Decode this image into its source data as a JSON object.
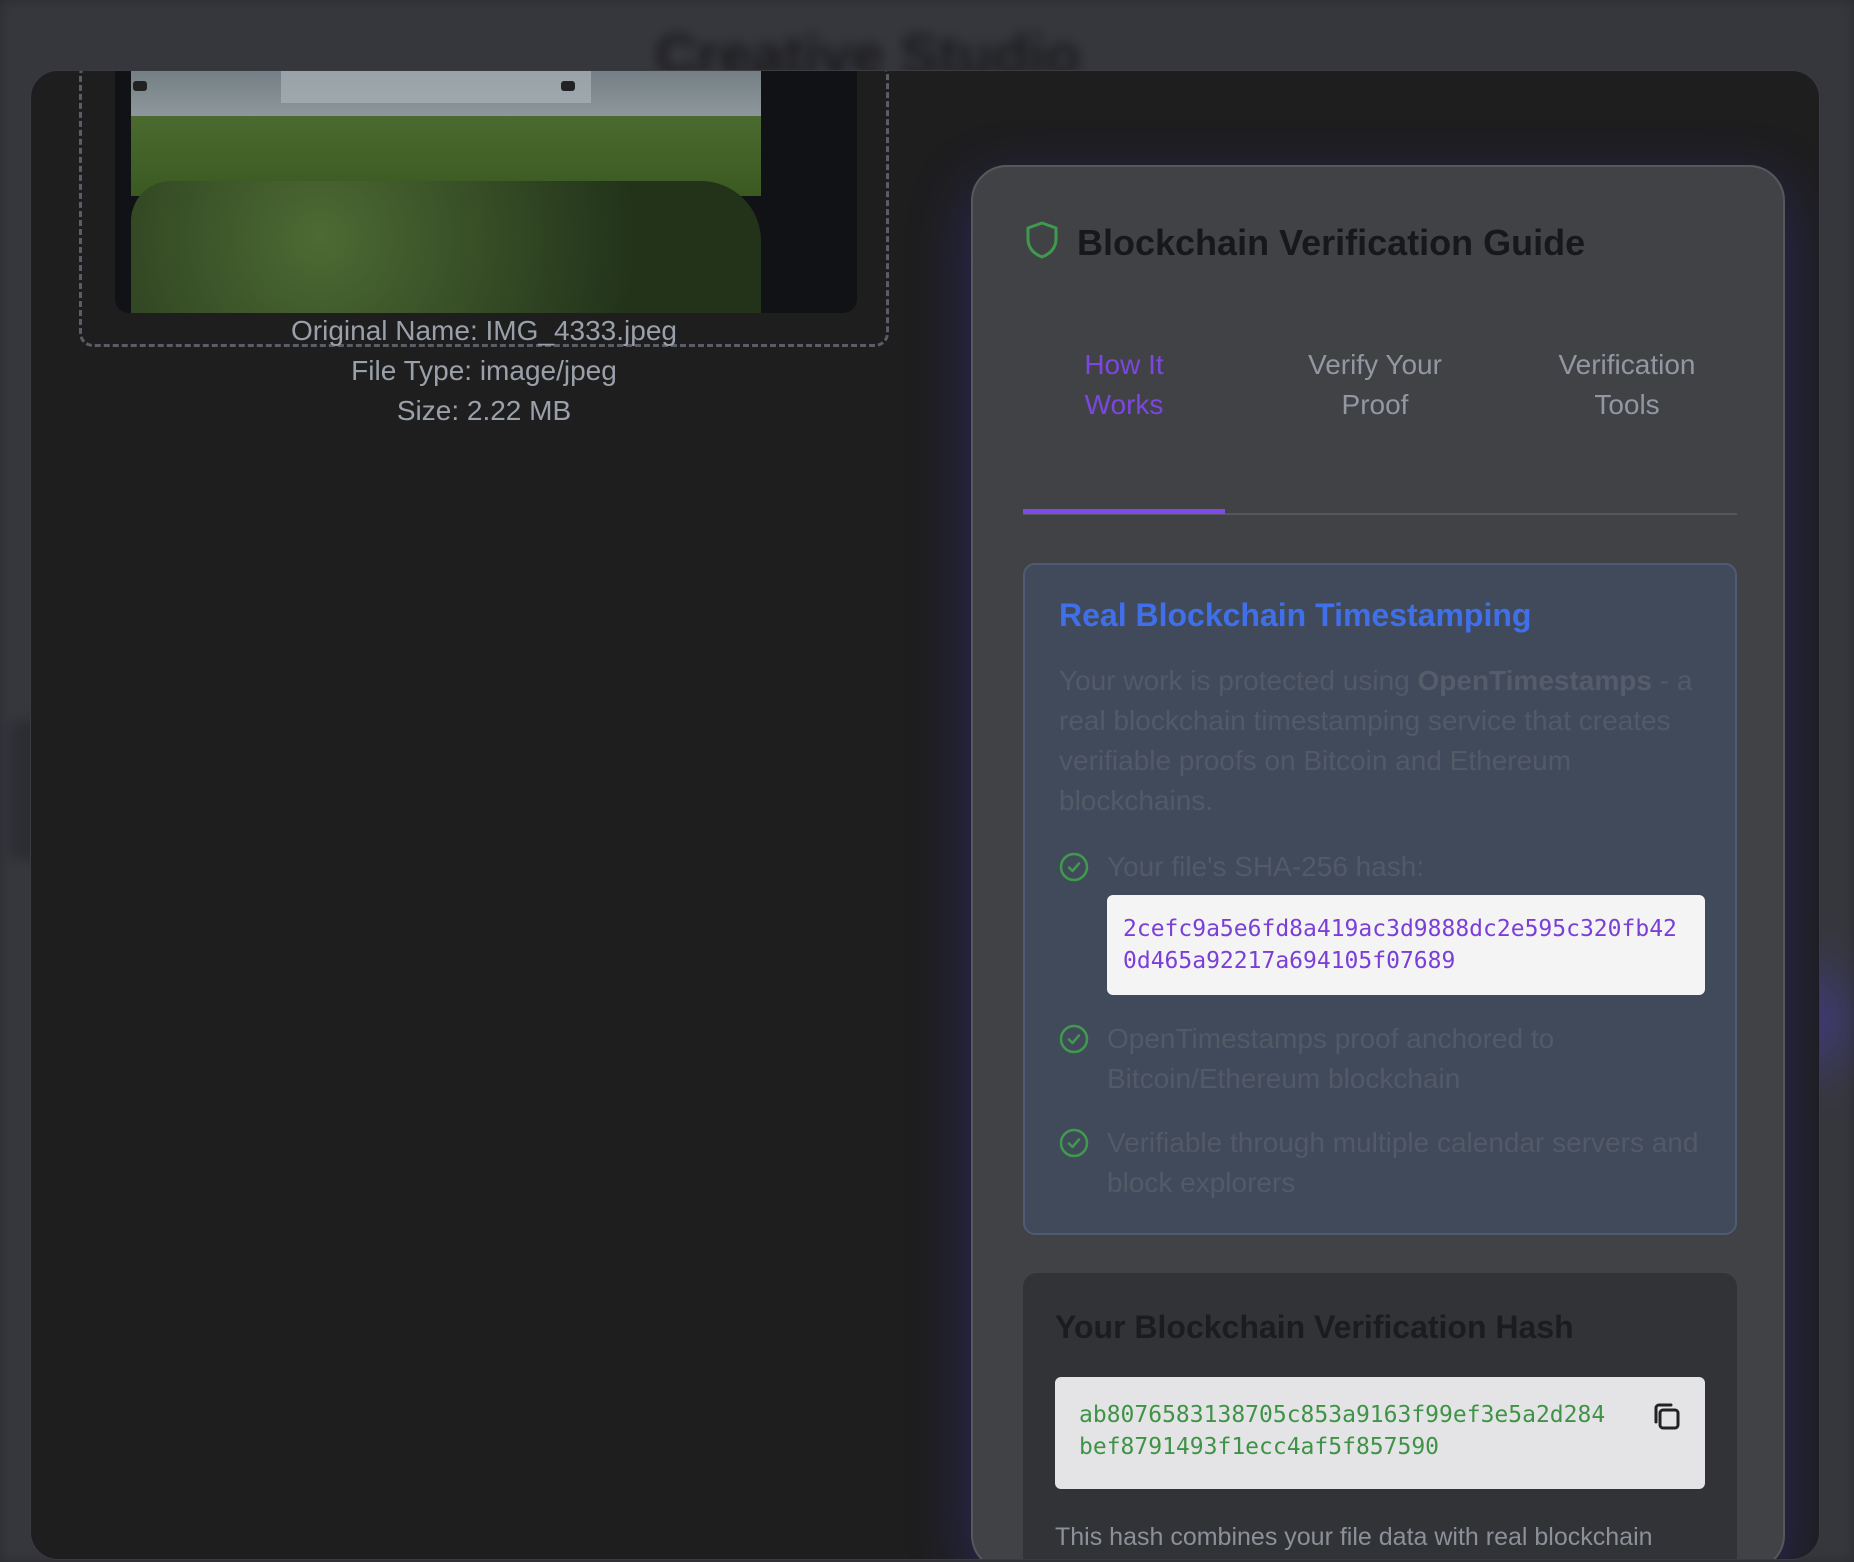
{
  "background": {
    "title": "Creative Studio"
  },
  "file": {
    "original_name": "Original Name: IMG_4333.jpeg",
    "file_type": "File Type: image/jpeg",
    "size": "Size: 2.22 MB"
  },
  "guide": {
    "title": "Blockchain Verification Guide",
    "icon": "shield-icon",
    "tabs": [
      {
        "label": "How It Works",
        "line1": "How It",
        "line2": "Works",
        "active": true
      },
      {
        "label": "Verify Your Proof",
        "line1": "Verify Your",
        "line2": "Proof",
        "active": false
      },
      {
        "label": "Verification Tools",
        "line1": "Verification",
        "line2": "Tools",
        "active": false
      }
    ],
    "info": {
      "title": "Real Blockchain Timestamping",
      "text_before": "Your work is protected using ",
      "text_bold": "OpenTimestamps",
      "text_after": " - a real blockchain timestamping service that creates verifiable proofs on Bitcoin and Ethereum blockchains.",
      "checks": [
        "Your file's SHA-256 hash:",
        "OpenTimestamps proof anchored to Bitcoin/Ethereum blockchain",
        "Verifiable through multiple calendar servers and block explorers"
      ],
      "sha256": "2cefc9a5e6fd8a419ac3d9888dc2e595c320fb420d465a92217a694105f07689"
    },
    "hash_card": {
      "title": "Your Blockchain Verification Hash",
      "hash": "ab8076583138705c853a9163f99ef3e5a2d284bef8791493f1ecc4af5f857590",
      "description": "This hash combines your file data with real blockchain information to create a tamper-proof timestamp.",
      "copy_icon": "copy-icon"
    }
  },
  "colors": {
    "accent_purple": "#7e4ae8",
    "accent_blue": "#3f70ea",
    "success_green": "#3f9346"
  }
}
